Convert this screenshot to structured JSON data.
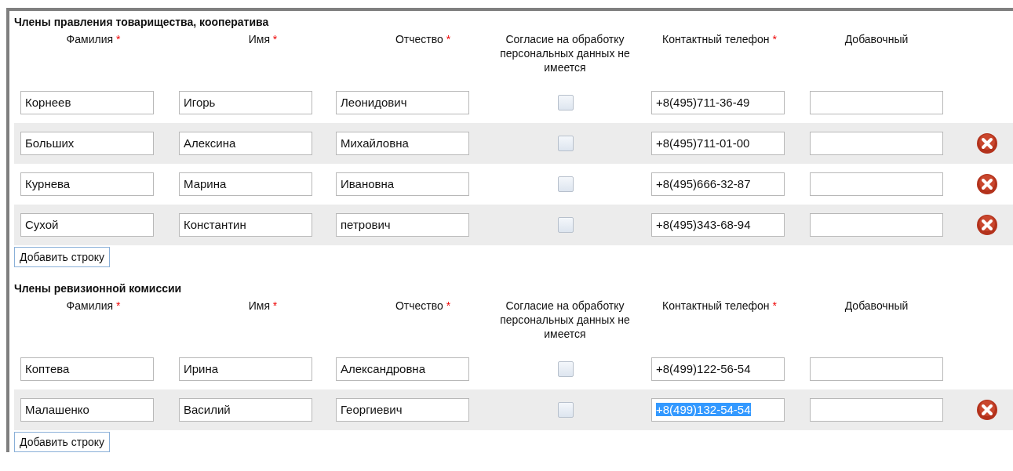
{
  "sections": [
    {
      "title": "Члены правления товарищества, кооператива",
      "columns": [
        {
          "label": "Фамилия",
          "required_mark": "*"
        },
        {
          "label": "Имя",
          "required_mark": "*"
        },
        {
          "label": "Отчество",
          "required_mark": "*"
        },
        {
          "label": "Согласие на обработку персональных данных не имеется"
        },
        {
          "label": "Контактный телефон",
          "required_mark": "*"
        },
        {
          "label": "Добавочный"
        }
      ],
      "rows": [
        {
          "last_name": "Корнеев",
          "first_name": "Игорь",
          "patronymic": "Леонидович",
          "checked": false,
          "phone": "+8(495)711-36-49",
          "phone_selected": false,
          "deletable": false
        },
        {
          "last_name": "Больших",
          "first_name": "Алексина",
          "patronymic": "Михайловна",
          "checked": false,
          "phone": "+8(495)711-01-00",
          "phone_selected": false,
          "deletable": true
        },
        {
          "last_name": "Курнева",
          "first_name": "Марина",
          "patronymic": "Ивановна",
          "checked": false,
          "phone": "+8(495)666-32-87",
          "phone_selected": false,
          "deletable": true
        },
        {
          "last_name": "Сухой",
          "first_name": "Константин",
          "patronymic": "петрович",
          "checked": false,
          "phone": "+8(495)343-68-94",
          "phone_selected": false,
          "deletable": true
        }
      ],
      "add_button": "Добавить строку"
    },
    {
      "title": "Члены ревизионной комиссии",
      "columns": [
        {
          "label": "Фамилия",
          "required_mark": "*"
        },
        {
          "label": "Имя",
          "required_mark": "*"
        },
        {
          "label": "Отчество",
          "required_mark": "*"
        },
        {
          "label": "Согласие на обработку персональных данных не имеется"
        },
        {
          "label": "Контактный телефон",
          "required_mark": "*"
        },
        {
          "label": "Добавочный"
        }
      ],
      "rows": [
        {
          "last_name": "Коптева",
          "first_name": "Ирина",
          "patronymic": "Александровна",
          "checked": false,
          "phone": "+8(499)122-56-54",
          "phone_selected": false,
          "deletable": false
        },
        {
          "last_name": "Малашенко",
          "first_name": "Василий",
          "patronymic": "Георгиевич",
          "checked": false,
          "phone": "+8(499)132-54-54",
          "phone_selected": true,
          "deletable": true
        }
      ],
      "add_button": "Добавить строку"
    }
  ]
}
